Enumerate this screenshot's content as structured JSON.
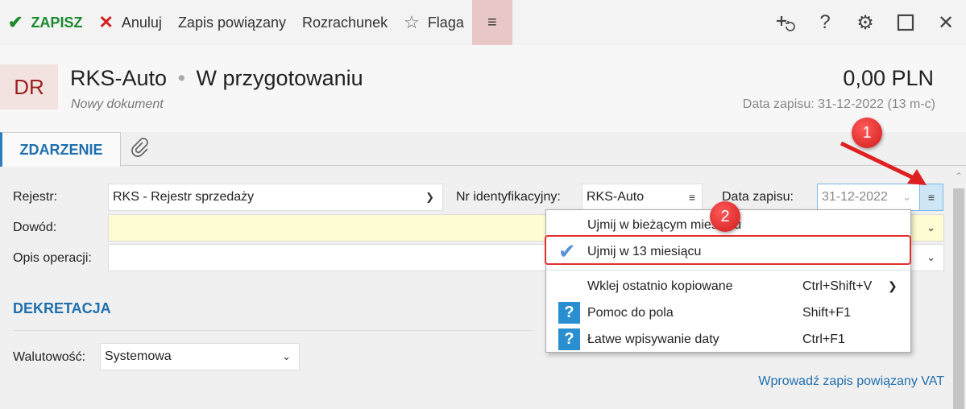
{
  "toolbar": {
    "save_label": "ZAPISZ",
    "cancel_label": "Anuluj",
    "linked_label": "Zapis powiązany",
    "settlement_label": "Rozrachunek",
    "flag_label": "Flaga",
    "menu_glyph": "≡",
    "right_icons": [
      "add-linked-icon",
      "help-icon",
      "gear-icon",
      "maximize-icon",
      "close-icon"
    ]
  },
  "header": {
    "badge": "DR",
    "name": "RKS-Auto",
    "separator": "•",
    "status": "W przygotowaniu",
    "subtitle": "Nowy dokument",
    "amount": "0,00 PLN",
    "date_info": "Data zapisu: 31-12-2022 (13 m-c)"
  },
  "tabs": {
    "active": "ZDARZENIE"
  },
  "form": {
    "register_label": "Rejestr:",
    "register_value": "RKS - Rejestr sprzedaży",
    "id_label": "Nr identyfikacyjny:",
    "id_value": "RKS-Auto",
    "date_label": "Data zapisu:",
    "date_value": "31-12-2022",
    "proof_label": "Dowód:",
    "desc_label": "Opis operacji:"
  },
  "dekretacja": {
    "title": "DEKRETACJA",
    "currency_label": "Walutowość:",
    "currency_value": "Systemowa"
  },
  "link_vat": "Wprowadź zapis powiązany VAT",
  "menu": {
    "items": [
      {
        "label": "Ujmij w bieżącym miesiącu",
        "shortcut": "",
        "icon": ""
      },
      {
        "label": "Ujmij w 13 miesiącu",
        "shortcut": "",
        "icon": "check-icon"
      },
      {
        "label": "Wklej ostatnio kopiowane",
        "shortcut": "Ctrl+Shift+V",
        "icon": ""
      },
      {
        "label": "Pomoc do pola",
        "shortcut": "Shift+F1",
        "icon": "help-icon"
      },
      {
        "label": "Łatwe wpisywanie daty",
        "shortcut": "Ctrl+F1",
        "icon": "help-icon"
      }
    ]
  },
  "annotations": {
    "marker1": "1",
    "marker2": "2",
    "accent": "#e03030"
  },
  "colors": {
    "brand_blue": "#1f6fae",
    "save_green": "#1a8a2e",
    "cancel_red": "#d42020",
    "proof_bg": "#fefcd2"
  }
}
